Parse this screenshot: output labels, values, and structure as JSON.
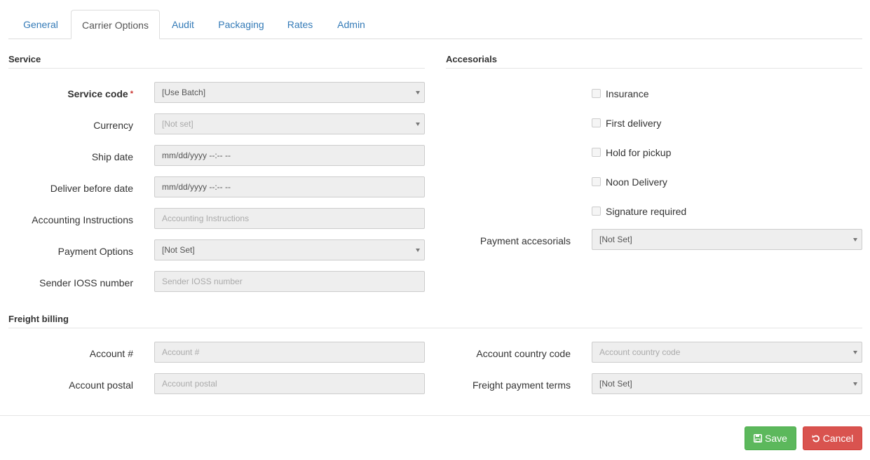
{
  "tabs": [
    {
      "label": "General"
    },
    {
      "label": "Carrier Options"
    },
    {
      "label": "Audit"
    },
    {
      "label": "Packaging"
    },
    {
      "label": "Rates"
    },
    {
      "label": "Admin"
    }
  ],
  "active_tab": "Carrier Options",
  "service": {
    "title": "Service",
    "service_code": {
      "label": "Service code",
      "required_mark": "*",
      "value": "[Use Batch]"
    },
    "currency": {
      "label": "Currency",
      "value": "[Not set]"
    },
    "ship_date": {
      "label": "Ship date",
      "value": "mm/dd/yyyy  --:-- --"
    },
    "deliver_before": {
      "label": "Deliver before date",
      "value": "mm/dd/yyyy  --:-- --"
    },
    "accounting_instructions": {
      "label": "Accounting Instructions",
      "placeholder": "Accounting Instructions"
    },
    "payment_options": {
      "label": "Payment Options",
      "value": "[Not Set]"
    },
    "sender_ioss": {
      "label": "Sender IOSS number",
      "placeholder": "Sender IOSS number"
    }
  },
  "accessorials": {
    "title": "Accesorials",
    "checkboxes": [
      {
        "label": "Insurance",
        "checked": false
      },
      {
        "label": "First delivery",
        "checked": false
      },
      {
        "label": "Hold for pickup",
        "checked": false
      },
      {
        "label": "Noon Delivery",
        "checked": false
      },
      {
        "label": "Signature required",
        "checked": false
      }
    ],
    "payment_accessorials": {
      "label": "Payment accesorials",
      "value": "[Not Set]"
    }
  },
  "freight_billing": {
    "title": "Freight billing",
    "account_number": {
      "label": "Account #",
      "placeholder": "Account #"
    },
    "account_postal": {
      "label": "Account postal",
      "placeholder": "Account postal"
    },
    "account_country_code": {
      "label": "Account country code",
      "placeholder": "Account country code"
    },
    "freight_payment_terms": {
      "label": "Freight payment terms",
      "value": "[Not Set]"
    }
  },
  "actions": {
    "save_label": "Save",
    "cancel_label": "Cancel"
  },
  "colors": {
    "link": "#337ab7",
    "save": "#5cb85c",
    "cancel": "#d9534f",
    "required": "#c9302c"
  },
  "icons": {
    "save": "floppy-disk-icon",
    "cancel": "undo-icon",
    "dropdown": "caret-down-icon"
  }
}
